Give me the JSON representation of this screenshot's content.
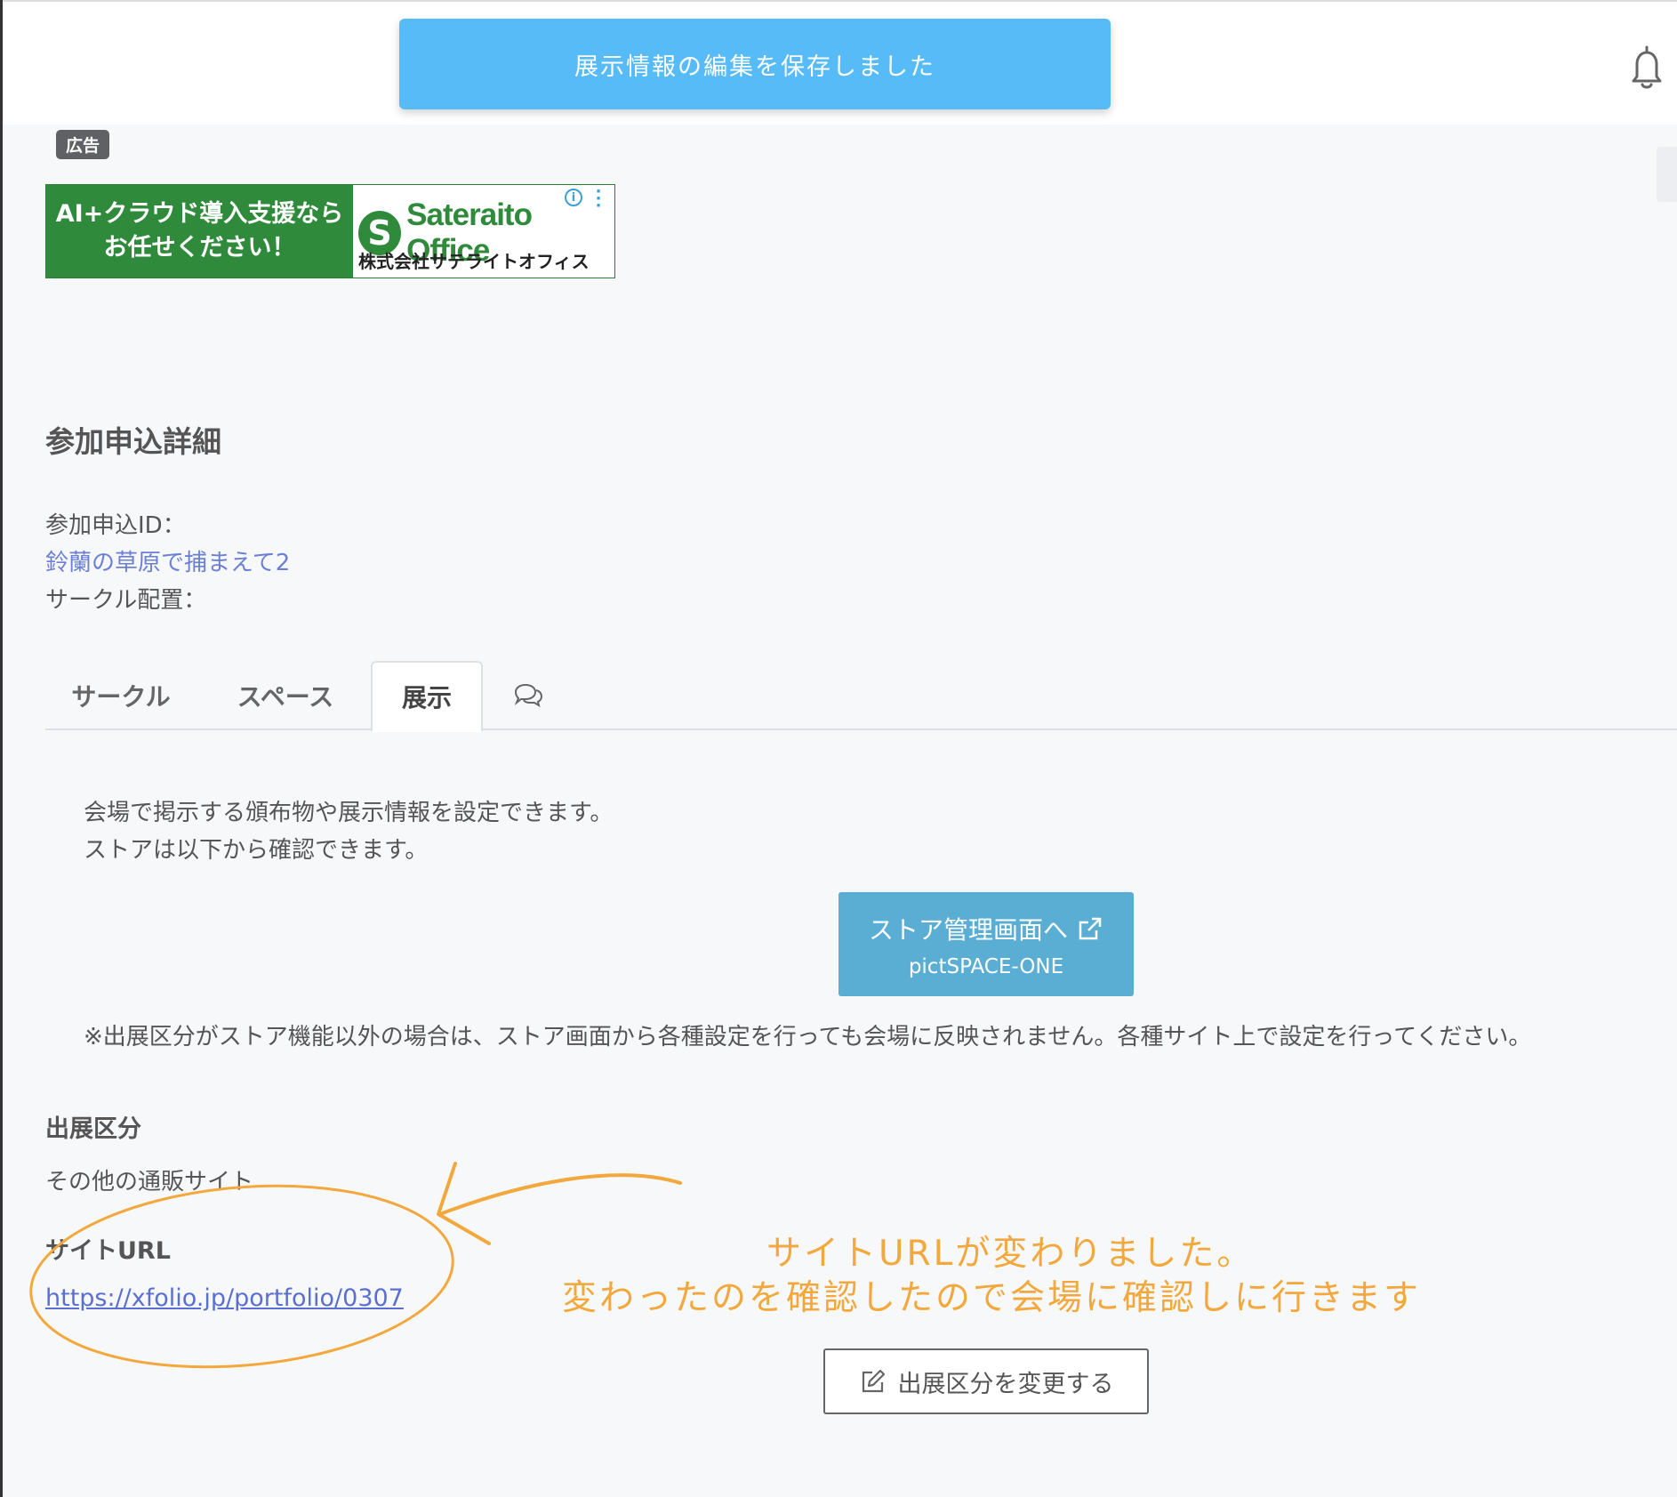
{
  "toast": {
    "message": "展示情報の編集を保存しました"
  },
  "ad": {
    "tag": "広告",
    "headline_line1": "AI+クラウド導入支援なら",
    "headline_line2": "お任せください！",
    "brand_initial": "S",
    "brand": "Sateraito Office",
    "company": "株式会社サテライトオフィス"
  },
  "page": {
    "title": "参加申込詳細"
  },
  "application": {
    "id_label": "参加申込ID：",
    "event_name": "鈴蘭の草原で捕まえて2",
    "placement_label": "サークル配置："
  },
  "tabs": [
    {
      "label": "サークル"
    },
    {
      "label": "スペース"
    },
    {
      "label": "展示"
    }
  ],
  "exhibit": {
    "description_line1": "会場で掲示する頒布物や展示情報を設定できます。",
    "description_line2": "ストアは以下から確認できます。",
    "store_button_label": "ストア管理画面へ",
    "store_button_sub": "pictSPACE-ONE",
    "note": "※出展区分がストア機能以外の場合は、ストア画面から各種設定を行っても会場に反映されません。各種サイト上で設定を行ってください。",
    "category_label": "出展区分",
    "category_value": "その他の通販サイト",
    "url_label": "サイトURL",
    "url_value": "https://xfolio.jp/portfolio/0307",
    "change_button_label": "出展区分を変更する"
  },
  "annotation": {
    "line1": "サイトURLが変わりました。",
    "line2": "変わったのを確認したので会場に確認しに行きます",
    "color": "#f2a83d"
  },
  "colors": {
    "toast": "#56bbf6",
    "store_button": "#5aaed3",
    "link": "#5a6fd0",
    "ad_green": "#2f8b3b"
  },
  "icons": {
    "bell": "bell-icon",
    "chat": "chat-icon",
    "external_link": "external-link-icon",
    "edit": "edit-icon"
  }
}
